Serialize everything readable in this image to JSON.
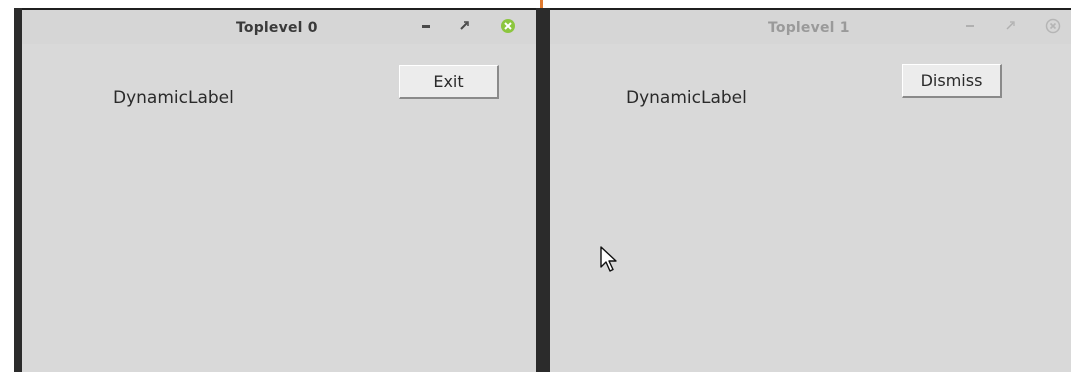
{
  "windows": [
    {
      "title": "Toplevel 0",
      "label": "DynamicLabel",
      "button_label": "Exit",
      "active": true,
      "controls": [
        "minimize-icon",
        "maximize-icon",
        "close-icon"
      ]
    },
    {
      "title": "Toplevel 1",
      "label": "DynamicLabel",
      "button_label": "Dismiss",
      "active": false,
      "controls": [
        "minimize-icon",
        "maximize-icon",
        "close-icon"
      ]
    }
  ],
  "colors": {
    "window_bg": "#d9d9d9",
    "titlebar_bg": "#d6d6d6",
    "active_close": "#8cc63e",
    "inactive_close": "#b5b5b5",
    "frame": "#2b2b2b",
    "accent": "#e07a2f"
  },
  "cursor": "mouse-pointer-icon"
}
